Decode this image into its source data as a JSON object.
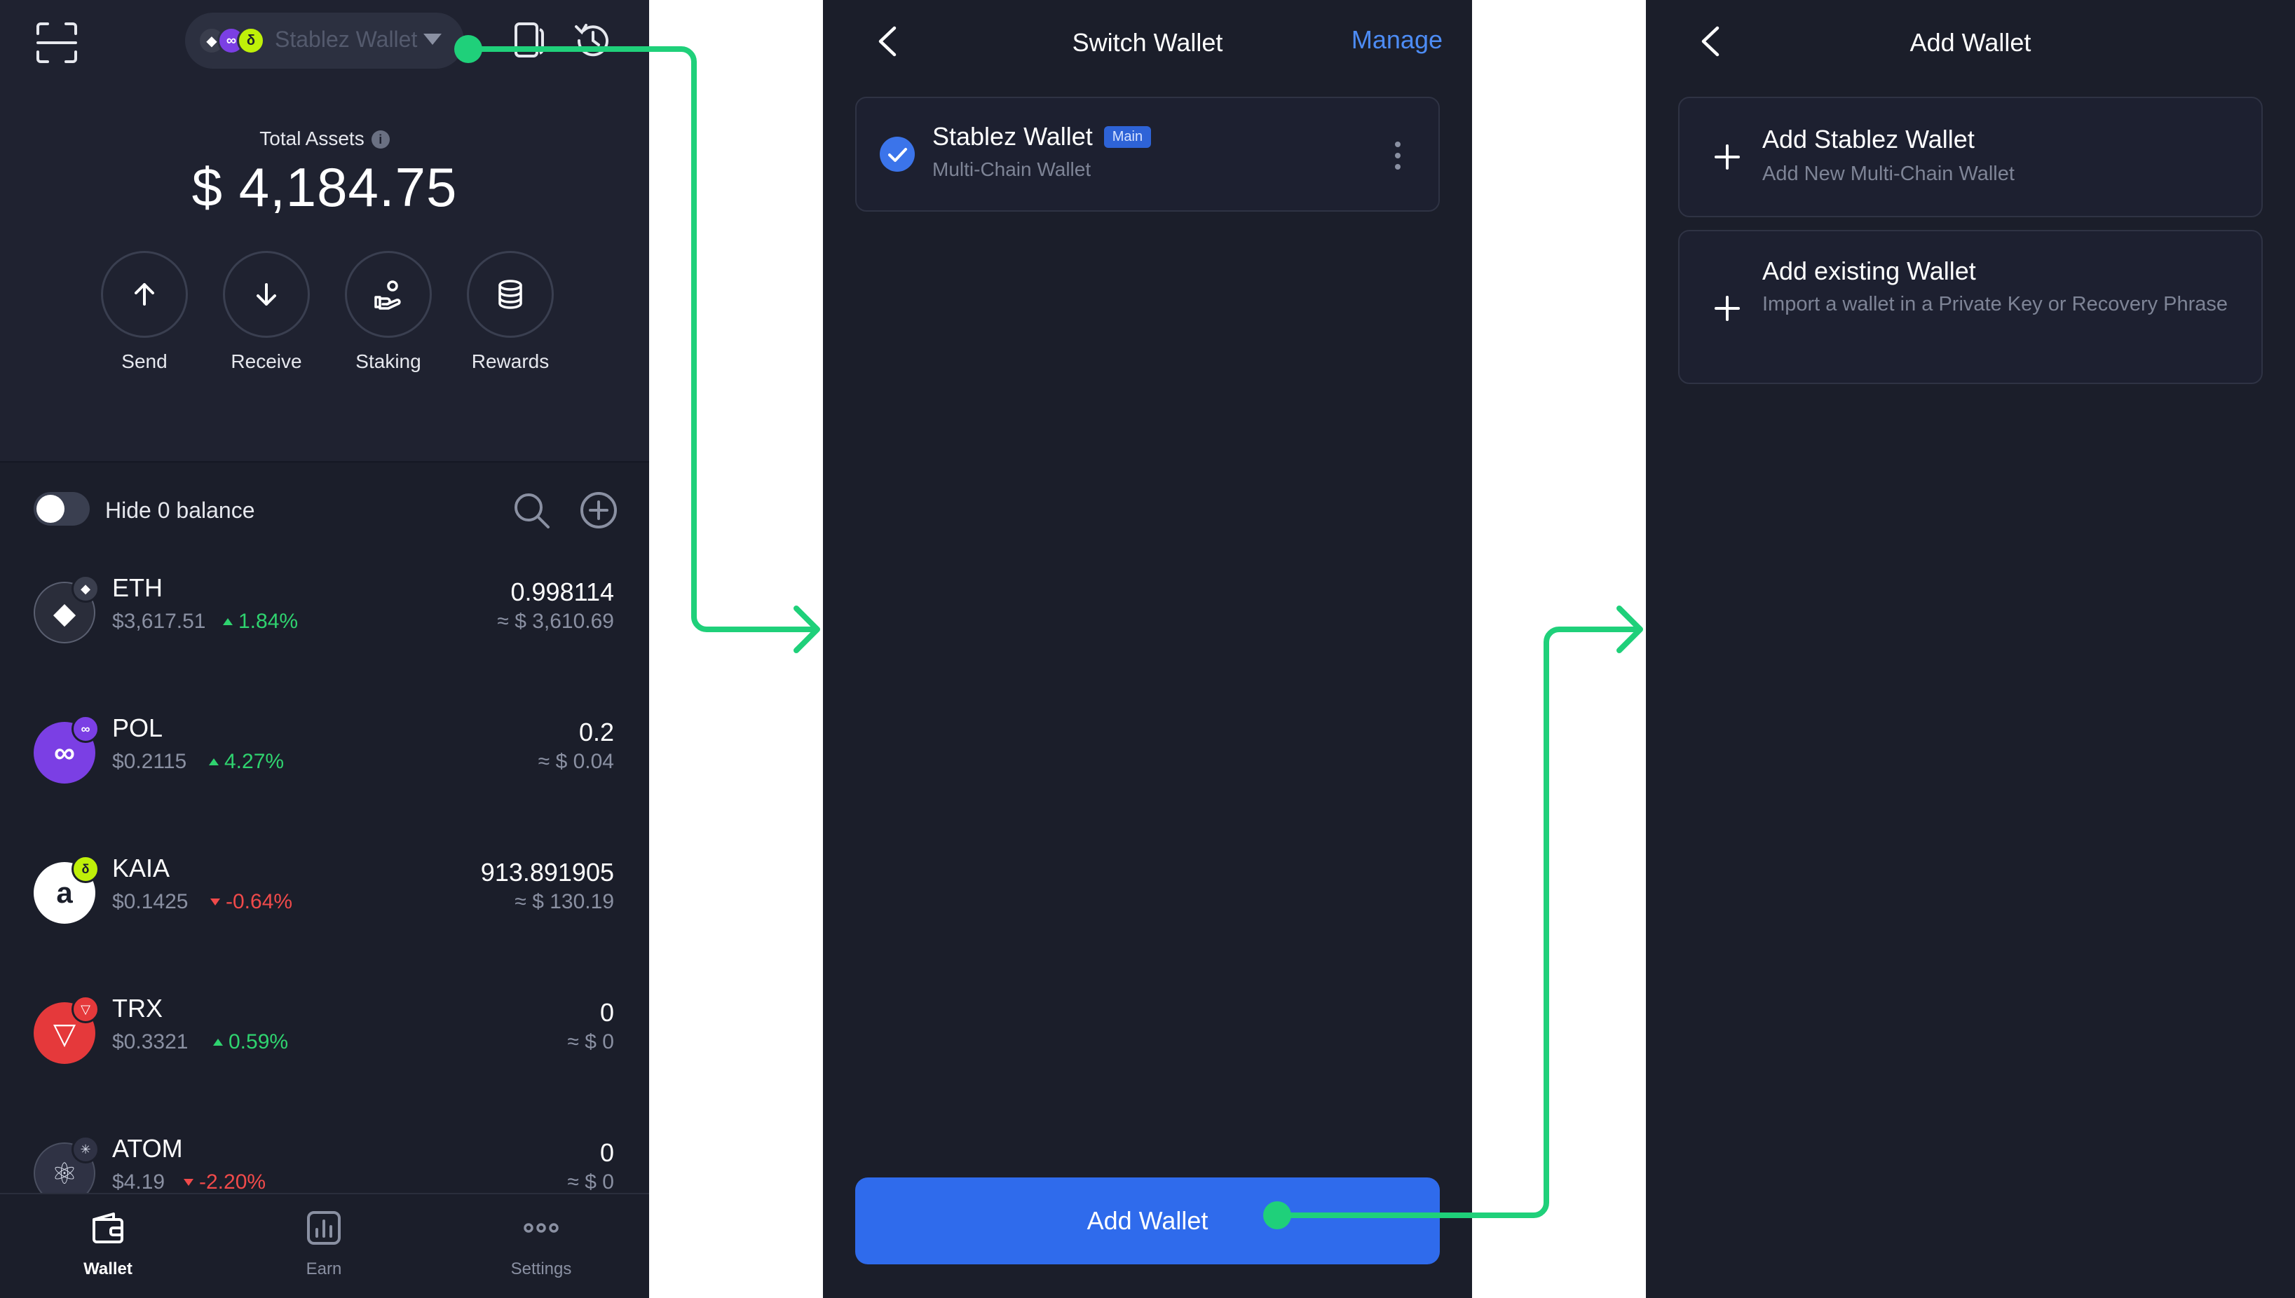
{
  "home": {
    "wallet_pill": {
      "chains": [
        "ETH",
        "POL",
        "KAIA"
      ],
      "name": "Stablez Wallet"
    },
    "total_assets_label": "Total Assets",
    "total_assets_value": "$ 4,184.75",
    "actions": [
      {
        "label": "Send",
        "icon": "arrow-up-icon"
      },
      {
        "label": "Receive",
        "icon": "arrow-down-icon"
      },
      {
        "label": "Staking",
        "icon": "staking-hand-icon"
      },
      {
        "label": "Rewards",
        "icon": "coin-stack-icon"
      }
    ],
    "hide_zero_label": "Hide 0 balance",
    "hide_zero_enabled": false,
    "tokens": [
      {
        "symbol": "ETH",
        "price": "$3,617.51",
        "change": "1.84%",
        "direction": "up",
        "amount": "0.998114",
        "fiat": "≈ $ 3,610.69",
        "icon_bg": "#2a2d3a",
        "badge_bg": "#3a3e4d"
      },
      {
        "symbol": "POL",
        "price": "$0.2115",
        "change": "4.27%",
        "direction": "up",
        "amount": "0.2",
        "fiat": "≈ $ 0.04",
        "icon_bg": "#7b3fe4",
        "badge_bg": "#7b3fe4"
      },
      {
        "symbol": "KAIA",
        "price": "$0.1425",
        "change": "-0.64%",
        "direction": "down",
        "amount": "913.891905",
        "fiat": "≈ $ 130.19",
        "icon_bg": "#ffffff",
        "badge_bg": "#bff009"
      },
      {
        "symbol": "TRX",
        "price": "$0.3321",
        "change": "0.59%",
        "direction": "up",
        "amount": "0",
        "fiat": "≈ $ 0",
        "icon_bg": "#e5393b",
        "badge_bg": "#e5393b"
      },
      {
        "symbol": "ATOM",
        "price": "$4.19",
        "change": "-2.20%",
        "direction": "down",
        "amount": "0",
        "fiat": "≈ $ 0",
        "icon_bg": "#2f3244",
        "badge_bg": "#2f3244"
      }
    ],
    "nav": [
      {
        "label": "Wallet",
        "active": true
      },
      {
        "label": "Earn",
        "active": false
      },
      {
        "label": "Settings",
        "active": false
      }
    ]
  },
  "switch_wallet": {
    "title": "Switch Wallet",
    "manage_label": "Manage",
    "wallets": [
      {
        "name": "Stablez Wallet",
        "badge": "Main",
        "subtitle": "Multi-Chain Wallet",
        "selected": true
      }
    ],
    "add_wallet_label": "Add Wallet"
  },
  "add_wallet": {
    "title": "Add Wallet",
    "options": [
      {
        "title": "Add Stablez Wallet",
        "subtitle": "Add New Multi-Chain Wallet"
      },
      {
        "title": "Add existing Wallet",
        "subtitle": "Import a wallet in a Private Key or Recovery Phrase"
      }
    ]
  },
  "colors": {
    "background": "#1b1e2a",
    "accent": "#2f6bec",
    "link": "#4d8cf5",
    "positive": "#2fd36f",
    "negative": "#f04a4a",
    "connector": "#1fd07a"
  }
}
